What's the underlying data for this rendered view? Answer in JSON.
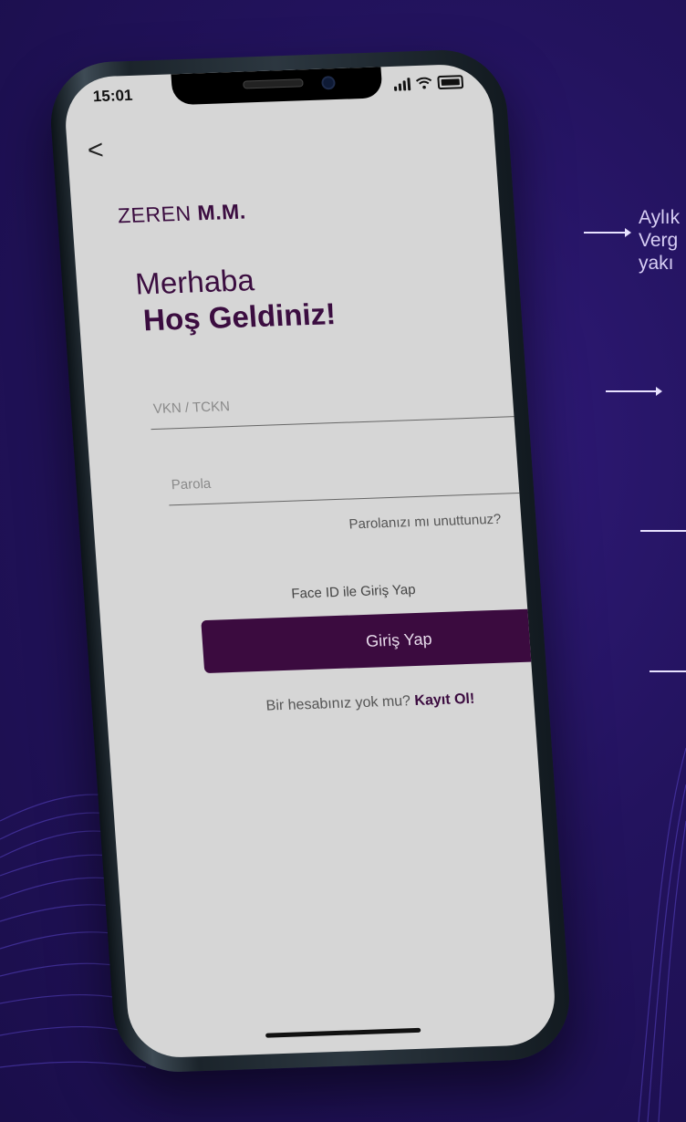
{
  "status": {
    "time": "15:01"
  },
  "nav": {
    "back_label": "<"
  },
  "brand": {
    "name_light": "ZEREN ",
    "name_bold": "M.M."
  },
  "greeting": {
    "line1": "Merhaba",
    "line2": "Hoş Geldiniz!"
  },
  "login": {
    "vkn_placeholder": "VKN / TCKN",
    "password_placeholder": "Parola",
    "forgot_label": "Parolanızı mı unuttunuz?",
    "faceid_label": "Face ID ile Giriş Yap",
    "submit_label": "Giriş Yap",
    "signup_prompt": "Bir hesabınız yok mu? ",
    "signup_link": "Kayıt Ol!"
  },
  "annotation": {
    "line1": "Aylık",
    "line2": "Verg",
    "line3": "yakı"
  },
  "colors": {
    "accent": "#3b0b3f",
    "screen_bg": "#d6d6d6",
    "page_bg": "#23135e"
  },
  "icons": [
    "back-chevron-icon",
    "signal-icon",
    "wifi-icon",
    "battery-icon",
    "eye-icon"
  ]
}
